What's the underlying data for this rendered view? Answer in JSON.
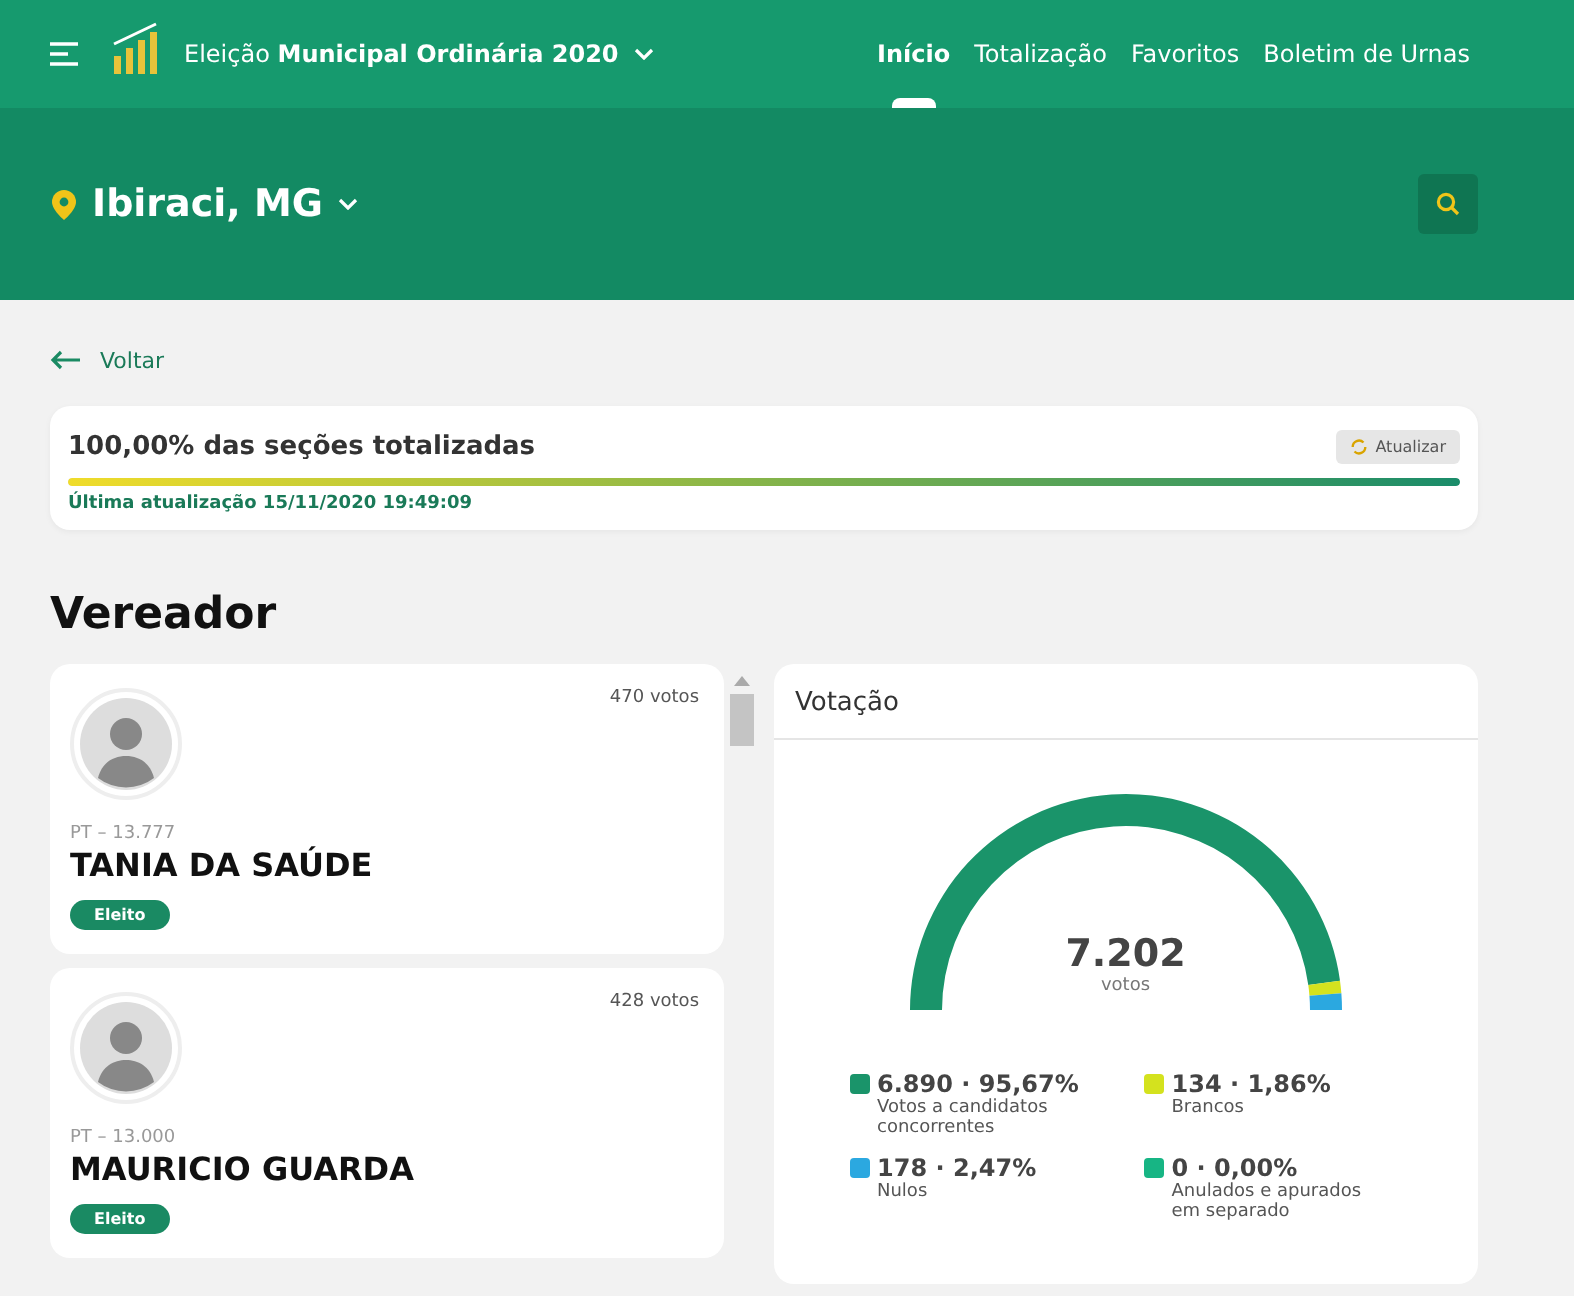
{
  "header": {
    "election_prefix": "Eleição",
    "election_name": "Municipal Ordinária 2020",
    "nav": [
      {
        "label": "Início",
        "selected": true
      },
      {
        "label": "Totalização",
        "selected": false
      },
      {
        "label": "Favoritos",
        "selected": false
      },
      {
        "label": "Boletim de Urnas",
        "selected": false
      }
    ]
  },
  "location": {
    "name": "Ibiraci, MG"
  },
  "back_link": "Voltar",
  "progress": {
    "title": "100,00% das seções totalizadas",
    "level": 1,
    "refresh_button": "Atualizar",
    "updated": "Última atualização 15/11/2020 19:49:09"
  },
  "section_title": "Vereador",
  "candidates": [
    {
      "votes": "470 votos",
      "party": "PT – 13.777",
      "name": "TANIA DA SAÚDE",
      "status": "Eleito"
    },
    {
      "votes": "428 votos",
      "party": "PT – 13.000",
      "name": "MAURICIO GUARDA",
      "status": "Eleito"
    }
  ],
  "votes_card": {
    "total": "7.202",
    "total_label": "votos",
    "chart_data": {
      "type": "donut",
      "categories": [
        "Votos a candidatos concorrentes",
        "Brancos",
        "Nulos",
        "Anulados e apurados em separado"
      ],
      "series": [
        {
          "name": "Votação",
          "values": [
            95.67,
            1.86,
            2.47,
            0
          ]
        }
      ]
    },
    "legend": [
      {
        "figure": "6.890 · 95,67%",
        "color": "#1a946a"
      },
      {
        "figure": "134 · 1,86%",
        "color": "#d4e21e"
      },
      {
        "figure": "178 · 2,47%",
        "color": "#2ba8e0"
      },
      {
        "figure": "0 · 0,00%",
        "color": "#17b584"
      }
    ]
  }
}
